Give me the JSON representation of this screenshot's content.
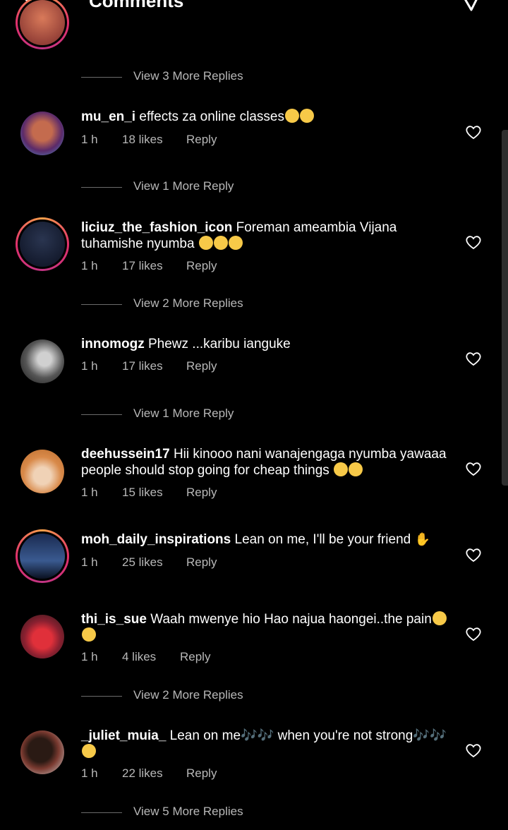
{
  "header": {
    "title": "Comments"
  },
  "view_more_top": "View 3 More Replies",
  "comments": [
    {
      "user": "mu_en_i",
      "text": "effects za online classes",
      "emoji": "😆😆",
      "time": "1 h",
      "likes": "18 likes",
      "reply": "Reply",
      "view_more": "View 1 More Reply"
    },
    {
      "user": "liciuz_the_fashion_icon",
      "text": "Foreman ameambia Vijana tuhamishe nyumba",
      "emoji": "😆😆😆",
      "time": "1 h",
      "likes": "17 likes",
      "reply": "Reply",
      "view_more": "View 2 More Replies"
    },
    {
      "user": "innomogz",
      "text": "Phewz ...karibu ianguke",
      "emoji": "",
      "time": "1 h",
      "likes": "17 likes",
      "reply": "Reply",
      "view_more": "View 1 More Reply"
    },
    {
      "user": "deehussein17",
      "text": "Hii kinooo nani wanajengaga nyumba yawaaa people should stop going for cheap things",
      "emoji": "😢😢",
      "time": "1 h",
      "likes": "15 likes",
      "reply": "Reply"
    },
    {
      "user": "moh_daily_inspirations",
      "text": "Lean on me, I'll be your friend",
      "emoji": "👏",
      "time": "1 h",
      "likes": "25 likes",
      "reply": "Reply"
    },
    {
      "user": "thi_is_sue",
      "text": "Waah mwenye hio Hao najua haongei..the pain",
      "emoji": "😢😢",
      "time": "1 h",
      "likes": "4 likes",
      "reply": "Reply",
      "view_more": "View 2 More Replies"
    },
    {
      "user": "_juliet_muia_",
      "text_a": "Lean on me",
      "notes_a": "🎶🎶",
      "text_b": "when you're not strong",
      "notes_b": "🎶🎶",
      "emoji": "😆",
      "time": "1 h",
      "likes": "22 likes",
      "reply": "Reply",
      "view_more": "View 5 More Replies"
    }
  ],
  "icons": {
    "like": "heart-outline-icon",
    "back": "arrow-left-icon",
    "send": "paper-plane-icon"
  },
  "colors": {
    "background": "#000000",
    "secondary_text": "#b8b8b8",
    "story_ring": "#e1306c"
  }
}
